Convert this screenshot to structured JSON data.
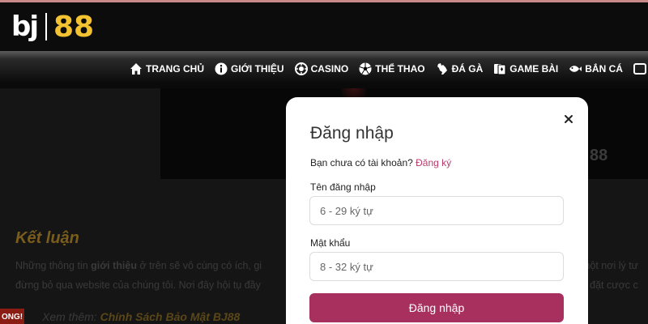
{
  "brand": {
    "left": "bj",
    "right": "88",
    "accent": "#f2c230"
  },
  "nav": {
    "items": [
      {
        "icon": "home-icon",
        "label": "TRANG CHỦ"
      },
      {
        "icon": "info-icon",
        "label": "GIỚI THIỆU"
      },
      {
        "icon": "casino-chip-icon",
        "label": "CASINO"
      },
      {
        "icon": "soccer-ball-icon",
        "label": "THỂ THAO"
      },
      {
        "icon": "rooster-icon",
        "label": "ĐÁ GÀ"
      },
      {
        "icon": "playing-cards-icon",
        "label": "GAME BÀI"
      },
      {
        "icon": "fish-icon",
        "label": "BẮN CÁ"
      }
    ]
  },
  "background_page": {
    "banner_text": "88",
    "heading": "Kết luận",
    "para1_pre": "Những thông tin ",
    "para1_bold": "giới thiệu",
    "para1_post": " ở trên sẽ vô cùng có ích, gi",
    "para1_right": "một nơi lý tư",
    "para2_left": "đừng bỏ qua website của chúng tôi. Nơi đây hội tụ đầy",
    "para2_right": "ích đặt cược c",
    "see_more_label": "Xem thêm: ",
    "see_more_link": "Chính Sách Bảo Mật BJ88",
    "edge_tag": "ONG!"
  },
  "login_modal": {
    "title": "Đăng nhập",
    "no_account_text": "Bạn chưa có tài khoản?",
    "register_link": "Đăng ký",
    "username_label": "Tên đăng nhập",
    "username_placeholder": "6 - 29 ký tự",
    "password_label": "Mật khẩu",
    "password_placeholder": "8 - 32 ký tự",
    "submit_label": "Đăng nhập",
    "button_color": "#a8305e",
    "link_color": "#b83a6c"
  }
}
